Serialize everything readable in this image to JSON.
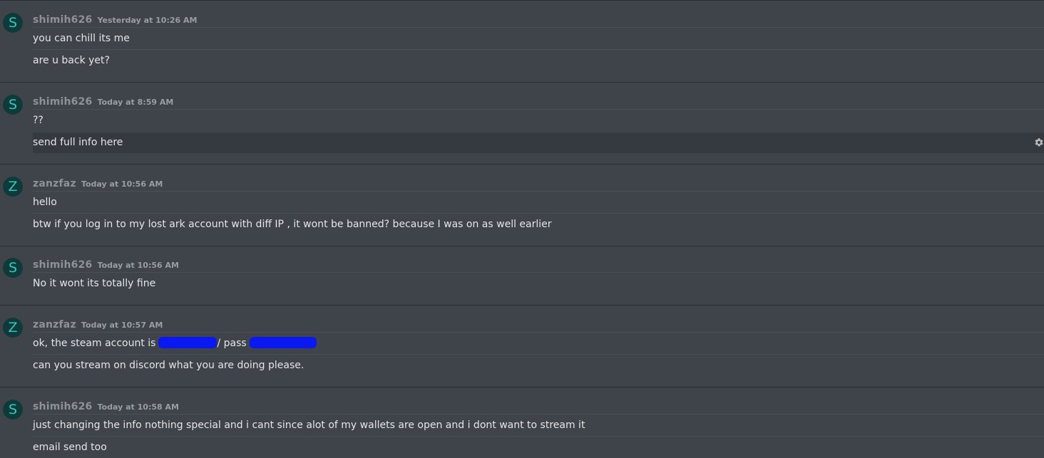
{
  "messages": [
    {
      "avatar_letter": "S",
      "author": "shimih626",
      "timestamp": "Yesterday at 10:26 AM",
      "lines": [
        "you can chill its me",
        "are u back yet?"
      ]
    },
    {
      "avatar_letter": "S",
      "author": "shimih626",
      "timestamp": "Today at 8:59 AM",
      "lines": [
        "??",
        "send full info here"
      ]
    },
    {
      "avatar_letter": "Z",
      "author": "zanzfaz",
      "timestamp": "Today at 10:56 AM",
      "lines": [
        "hello",
        "btw if you log in to my lost ark account with diff IP , it wont be banned? because I was on as well earlier"
      ]
    },
    {
      "avatar_letter": "S",
      "author": "shimih626",
      "timestamp": "Today at 10:56 AM",
      "lines": [
        "No it wont its totally fine"
      ]
    },
    {
      "avatar_letter": "Z",
      "author": "zanzfaz",
      "timestamp": "Today at 10:57 AM",
      "lines": [
        "ok, the steam account is",
        "/ pass",
        "can you stream on discord what you are doing please."
      ]
    },
    {
      "avatar_letter": "S",
      "author": "shimih626",
      "timestamp": "Today at 10:58 AM",
      "lines": [
        "just changing the info nothing special and i cant since alot of my wallets are open and i dont want to stream it",
        "email send too"
      ]
    }
  ],
  "icons": {
    "hover_action": "gear-icon"
  },
  "colors": {
    "background": "#3f444b",
    "hover_background": "#353a40",
    "avatar_text": "#34c7c0",
    "redaction": "#0a18f2"
  }
}
